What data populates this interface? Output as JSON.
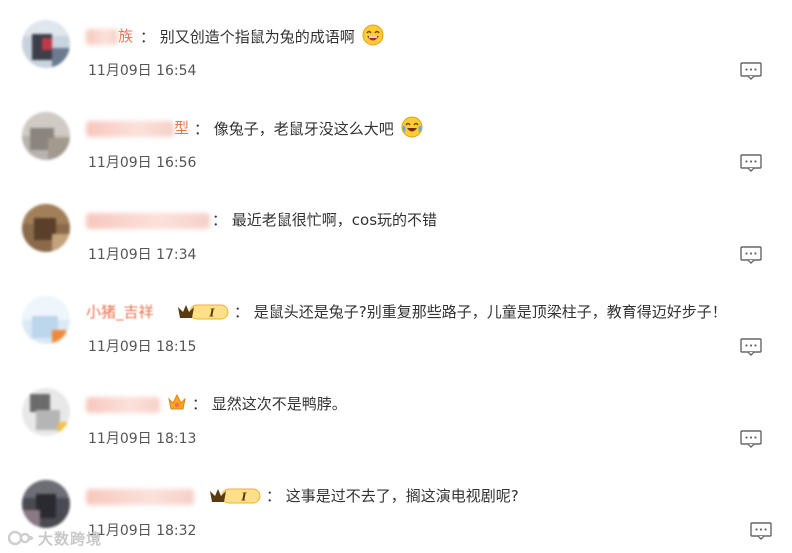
{
  "comments": [
    {
      "name_visible": "族",
      "separator": "：",
      "text": "别又创造个指鼠为兔的成语啊",
      "emoji": "laughing-emoji",
      "time": "11月09日 16:54"
    },
    {
      "name_visible": "型",
      "separator": "：",
      "text": "像兔子，老鼠牙没这么大吧",
      "emoji": "crying-laughing-emoji",
      "time": "11月09日 16:56"
    },
    {
      "name_visible": "",
      "separator": "：",
      "text": "最近老鼠很忙啊，cos玩的不错",
      "emoji": "",
      "time": "11月09日 17:34"
    },
    {
      "name_visible": "小猪_吉祥",
      "separator": "：",
      "text": "是鼠头还是兔子?别重复那些路子，儿童是顶梁柱子，教育得迈好步子！",
      "emoji": "",
      "badge_level": "I",
      "time": "11月09日 18:15"
    },
    {
      "name_visible": "",
      "separator": "：",
      "text": "显然这次不是鸭脖。",
      "emoji": "",
      "time": "11月09日 18:13"
    },
    {
      "name_visible": "",
      "separator": "：",
      "text": "这事是过不去了，搁这演电视剧呢?",
      "emoji": "",
      "badge_level": "I",
      "time": "11月09日 18:32"
    }
  ],
  "watermark": "大数跨境",
  "colors": {
    "username": "#eb7350",
    "text": "#333333",
    "time": "#555555",
    "badge_gold": "#f5a623"
  }
}
